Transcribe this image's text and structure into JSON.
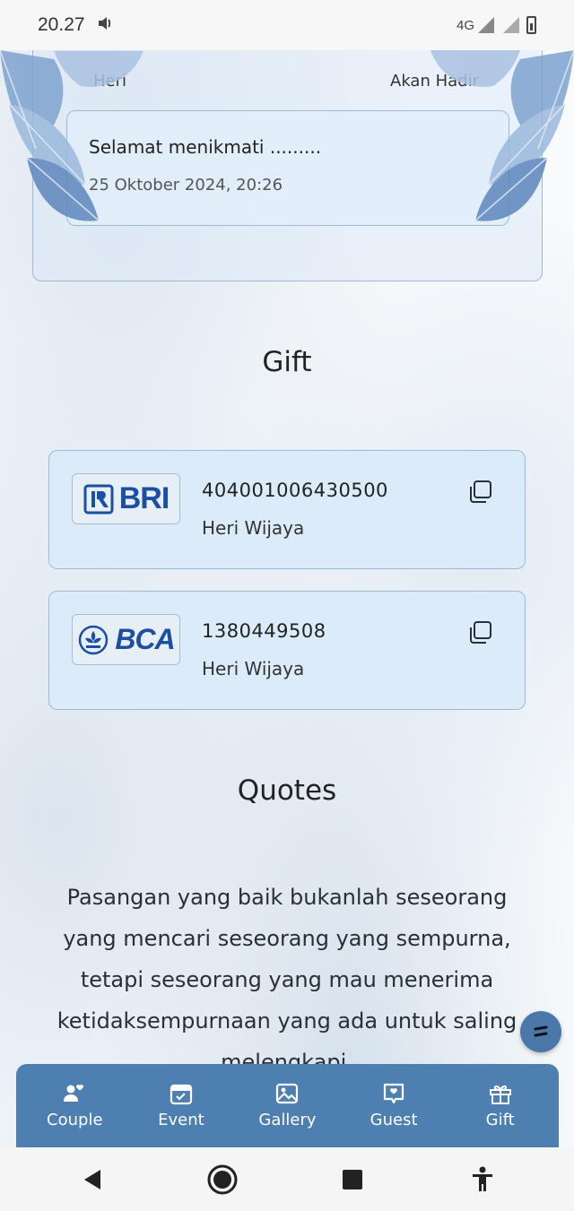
{
  "status_bar": {
    "time": "20.27",
    "network": "4G"
  },
  "wishes": {
    "sender_name": "Heri",
    "attendance": "Akan Hadir",
    "message": "Selamat menikmati .........",
    "date": "25 Oktober 2024, 20:26"
  },
  "gift": {
    "title": "Gift",
    "accounts": [
      {
        "bank": "BRI",
        "number": "404001006430500",
        "holder": "Heri Wijaya"
      },
      {
        "bank": "BCA",
        "number": "1380449508",
        "holder": "Heri Wijaya"
      }
    ]
  },
  "quotes": {
    "title": "Quotes",
    "lines": [
      "Pasangan yang baik bukanlah seseorang",
      "yang mencari seseorang yang sempurna,",
      "tetapi seseorang yang mau menerima",
      "ketidaksempurnaan yang ada untuk saling",
      "melengkapi."
    ]
  },
  "bottom_nav": {
    "items": [
      {
        "label": "Couple",
        "icon": "couple-icon"
      },
      {
        "label": "Event",
        "icon": "calendar-icon"
      },
      {
        "label": "Gallery",
        "icon": "gallery-icon"
      },
      {
        "label": "Guest",
        "icon": "guest-book-icon"
      },
      {
        "label": "Gift",
        "icon": "gift-icon"
      }
    ]
  },
  "colors": {
    "accent": "#4d7fb0",
    "card_bg": "#dcebfa",
    "card_border": "#9fb9d4"
  }
}
